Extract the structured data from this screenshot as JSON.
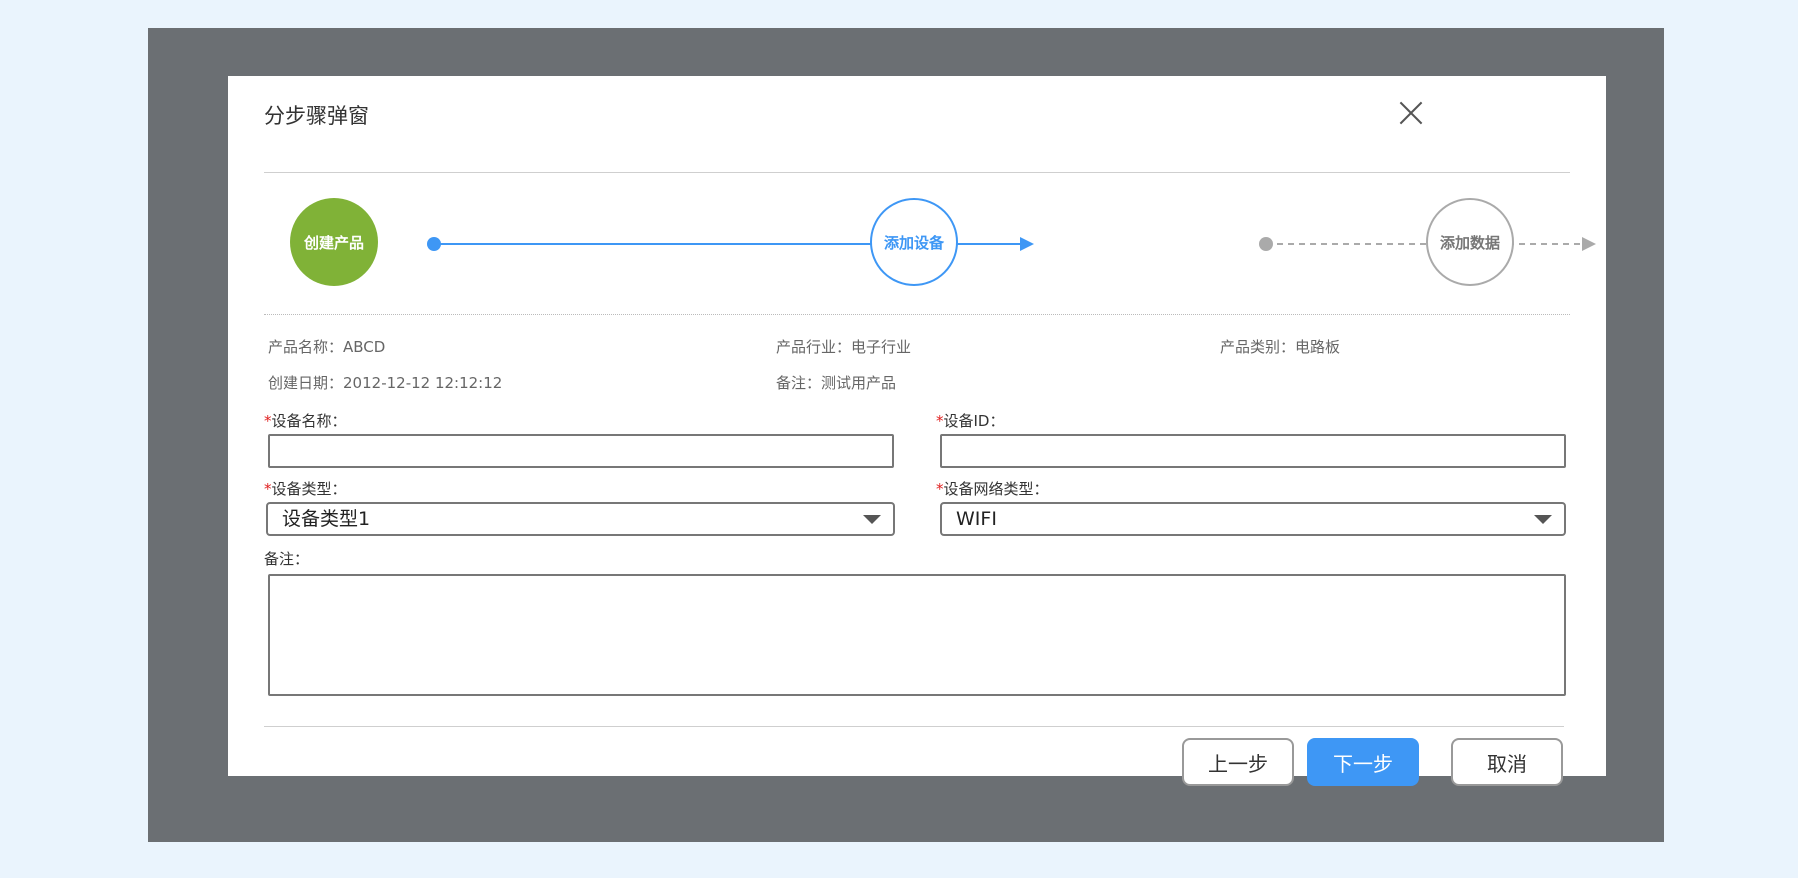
{
  "dialog": {
    "title": "分步骤弹窗",
    "close_icon": "close-icon"
  },
  "steps": [
    {
      "label": "创建产品",
      "state": "done",
      "color": "#80b237"
    },
    {
      "label": "添加设备",
      "state": "active",
      "color": "#3e97f5"
    },
    {
      "label": "添加数据",
      "state": "pending",
      "color": "#aaaaaa"
    }
  ],
  "info": {
    "product_name_label": "产品名称：",
    "product_name": "ABCD",
    "industry_label": "产品行业：",
    "industry": "电子行业",
    "category_label": "产品类别：",
    "category": "电路板",
    "created_label": "创建日期：",
    "created": "2012-12-12 12:12:12",
    "remark_label": "备注：",
    "remark": "测试用产品"
  },
  "form": {
    "required_mark": "*",
    "device_name_label": "设备名称：",
    "device_name_value": "",
    "device_id_label": "设备ID：",
    "device_id_value": "",
    "device_type_label": "设备类型：",
    "device_type_value": "设备类型1",
    "network_type_label": "设备网络类型：",
    "network_type_value": "WIFI",
    "remark_label": "备注：",
    "remark_value": ""
  },
  "buttons": {
    "prev": "上一步",
    "next": "下一步",
    "cancel": "取消"
  },
  "colors": {
    "backdrop": "#6b6f73",
    "primary": "#3e97f5",
    "success": "#80b237",
    "required": "#e02020"
  }
}
